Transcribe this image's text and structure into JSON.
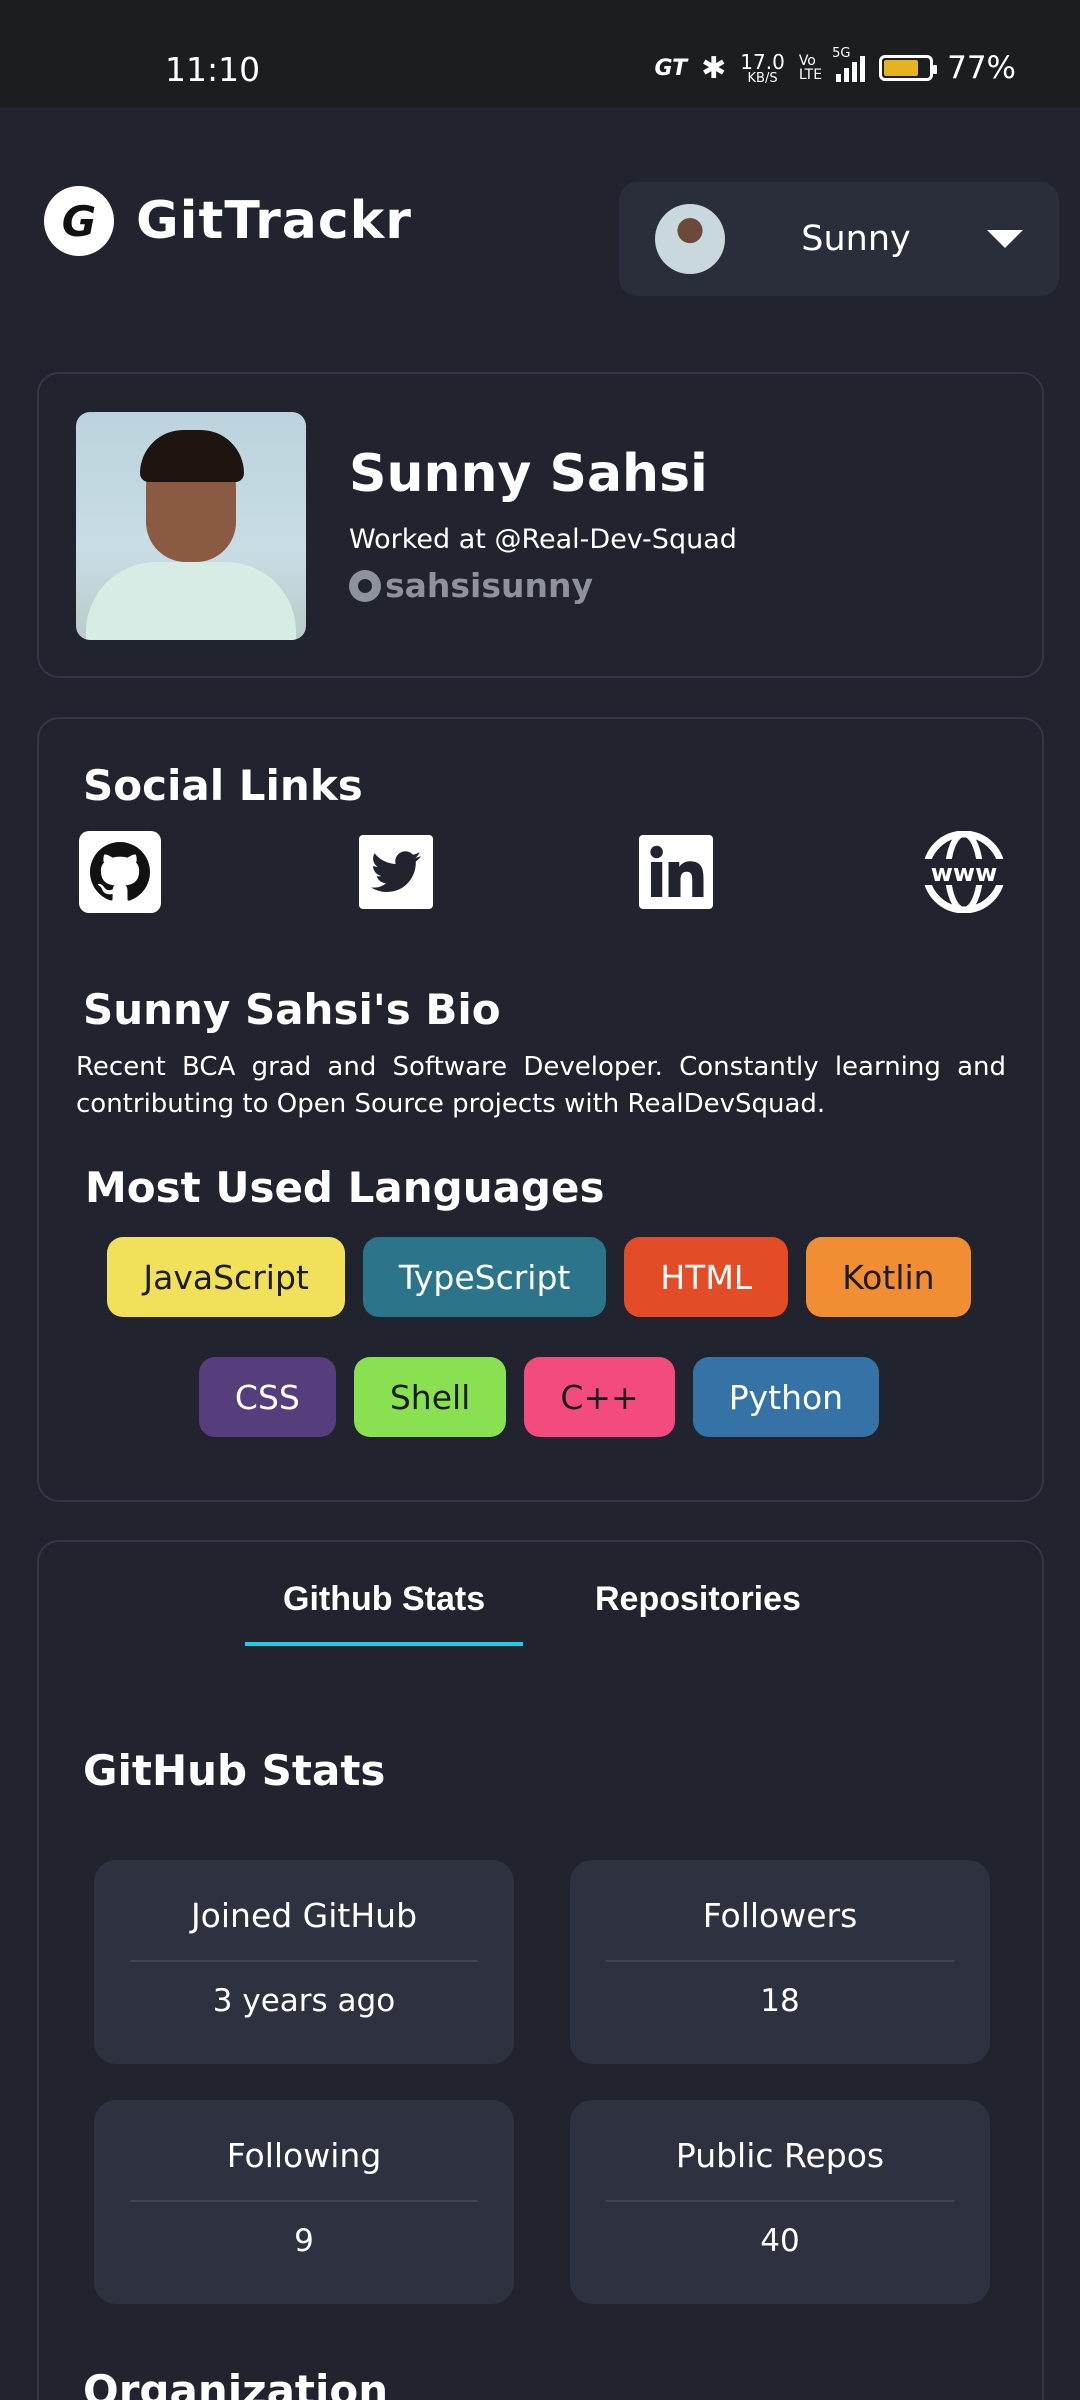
{
  "status_bar": {
    "time": "11:10",
    "gt_label": "GT",
    "speed_value": "17.0",
    "speed_unit": "KB/S",
    "volte_top": "Vo",
    "volte_bottom": "LTE",
    "network": "5G",
    "battery_level": 0.77,
    "battery_percent": "77%",
    "battery_color": "#e7b21f"
  },
  "header": {
    "app_name": "GitTrackr",
    "logo_glyph": "G",
    "user_menu_name": "Sunny"
  },
  "profile": {
    "name": "Sunny Sahsi",
    "work": "Worked at @Real-Dev-Squad",
    "handle": "sahsisunny"
  },
  "social": {
    "title": "Social Links",
    "links": [
      {
        "icon": "github-icon"
      },
      {
        "icon": "twitter-icon"
      },
      {
        "icon": "linkedin-icon"
      },
      {
        "icon": "website-icon"
      }
    ]
  },
  "bio": {
    "title": "Sunny Sahsi's Bio",
    "text": "Recent BCA grad and Software Developer. Constantly learning and contributing to Open Source projects with RealDevSquad."
  },
  "languages": {
    "title": "Most Used Languages",
    "items": [
      {
        "name": "JavaScript",
        "bg": "#f1e05a",
        "fg": "#1c1c1c"
      },
      {
        "name": "TypeScript",
        "bg": "#2b7489",
        "fg": "#ffffff"
      },
      {
        "name": "HTML",
        "bg": "#e34c26",
        "fg": "#ffffff"
      },
      {
        "name": "Kotlin",
        "bg": "#f18e33",
        "fg": "#1c1c1c"
      },
      {
        "name": "CSS",
        "bg": "#563d7c",
        "fg": "#ffffff"
      },
      {
        "name": "Shell",
        "bg": "#89e051",
        "fg": "#1c1c1c"
      },
      {
        "name": "C++",
        "bg": "#f34b7d",
        "fg": "#1c1c1c"
      },
      {
        "name": "Python",
        "bg": "#3572a5",
        "fg": "#ffffff"
      }
    ]
  },
  "tabs": [
    {
      "label": "Github Stats",
      "active": true
    },
    {
      "label": "Repositories",
      "active": false
    }
  ],
  "stats": {
    "title": "GitHub Stats",
    "items": [
      {
        "label": "Joined GitHub",
        "value": "3 years ago"
      },
      {
        "label": "Followers",
        "value": "18"
      },
      {
        "label": "Following",
        "value": "9"
      },
      {
        "label": "Public Repos",
        "value": "40"
      }
    ]
  },
  "organization": {
    "title": "Organization"
  },
  "colors": {
    "background": "#21232f",
    "card_border": "#333746",
    "tab_accent": "#18d0e8",
    "stat_box": "#2e3140"
  }
}
